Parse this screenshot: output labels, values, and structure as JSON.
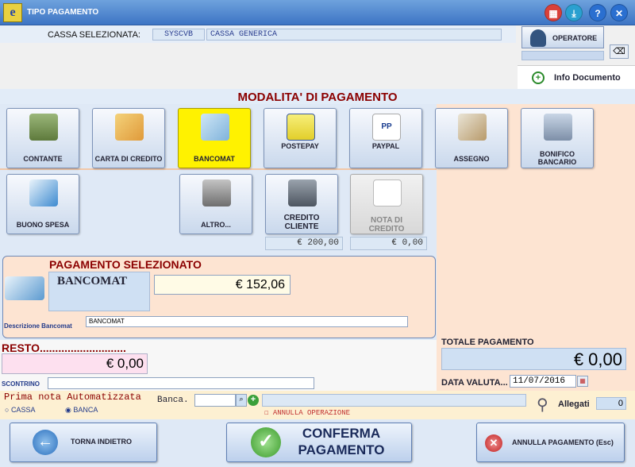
{
  "window": {
    "title": "TIPO PAGAMENTO"
  },
  "cassa": {
    "label": "CASSA SELEZIONATA:",
    "code": "SYSCVB",
    "name": "CASSA GENERICA"
  },
  "operatore": {
    "label": "OPERATORE"
  },
  "info_documento": {
    "label": "Info Documento"
  },
  "section_title": "MODALITA' DI PAGAMENTO",
  "payment_methods": [
    {
      "label": "CONTANTE"
    },
    {
      "label": "CARTA DI CREDITO"
    },
    {
      "label": "BANCOMAT"
    },
    {
      "label": "POSTEPAY"
    },
    {
      "label": "PAYPAL"
    },
    {
      "label": "ASSEGNO"
    },
    {
      "label": "BONIFICO BANCARIO"
    },
    {
      "label": "BUONO SPESA"
    },
    {
      "label": "ALTRO..."
    },
    {
      "label": "CREDITO CLIENTE",
      "amount": "€ 200,00"
    },
    {
      "label": "NOTA DI CREDITO",
      "amount": "€ 0,00"
    }
  ],
  "selected_payment": {
    "heading": "PAGAMENTO SELEZIONATO",
    "method": "BANCOMAT",
    "amount": "€ 152,06",
    "description_label": "Descrizione Bancomat",
    "description_value": "BANCOMAT"
  },
  "resto": {
    "label": "RESTO............................",
    "value": "€ 0,00"
  },
  "scontrino": {
    "label": "SCONTRINO",
    "value": ""
  },
  "totale": {
    "label": "TOTALE PAGAMENTO",
    "value": "€ 0,00"
  },
  "data_valuta": {
    "label": "DATA VALUTA...",
    "value": "11/07/2016"
  },
  "prima_nota": {
    "label": "Prima nota Automatizzata",
    "options": [
      "CASSA",
      "BANCA"
    ],
    "selected": "BANCA",
    "banca_label": "Banca.",
    "annulla_operazione": "ANNULLA OPERAZIONE"
  },
  "allegati": {
    "label": "Allegati",
    "count": "0"
  },
  "buttons": {
    "back": "TORNA INDIETRO",
    "confirm_line1": "CONFERMA",
    "confirm_line2": "PAGAMENTO",
    "cancel": "ANNULLA PAGAMENTO (Esc)"
  },
  "colors": {
    "accent": "#3d74c4",
    "section_title": "#8b0000",
    "selected_tile": "#fff200",
    "panel": "#fde4d2"
  }
}
